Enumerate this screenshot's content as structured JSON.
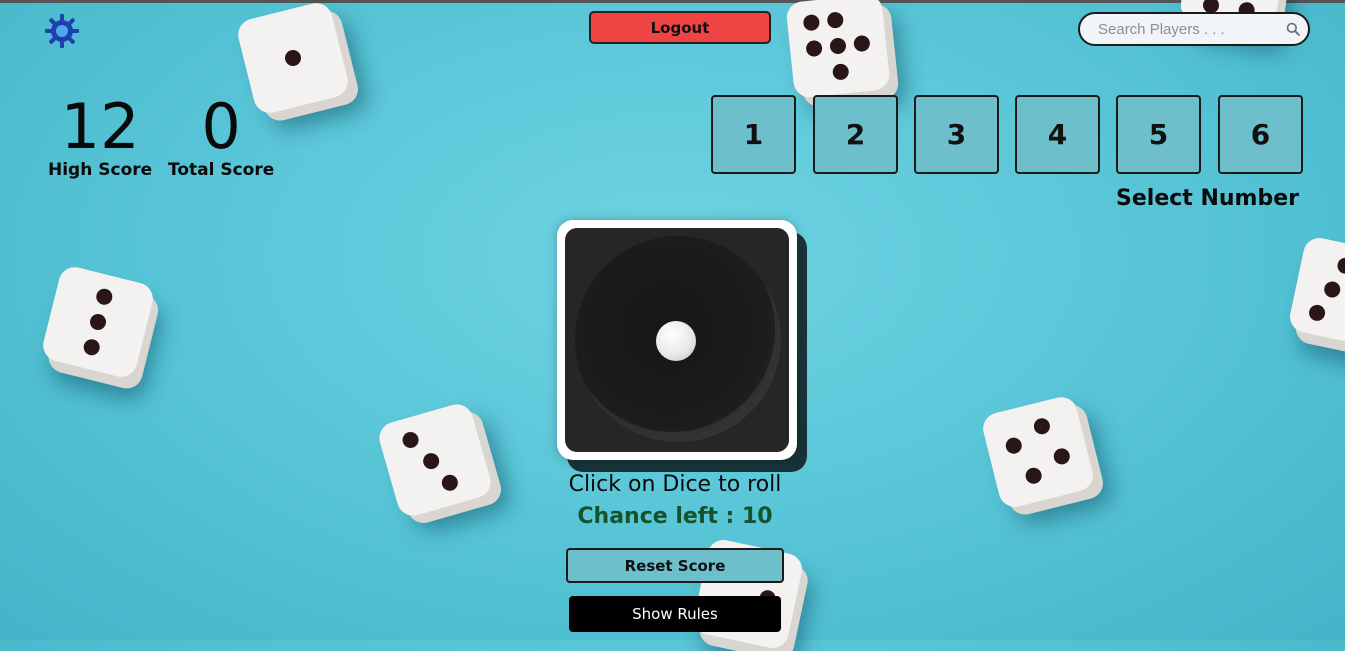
{
  "header": {
    "settings_icon": "gear-icon",
    "logout_label": "Logout",
    "search_placeholder": "Search Players . . .",
    "search_value": "",
    "search_icon": "magnifier-icon"
  },
  "scores": {
    "high_score": "12",
    "high_score_label": "High Score",
    "total_score": "0",
    "total_score_label": "Total Score"
  },
  "number_selector": {
    "options": [
      "1",
      "2",
      "3",
      "4",
      "5",
      "6"
    ],
    "label": "Select Number"
  },
  "dice": {
    "current_face": 1,
    "hint": "Click on Dice to roll",
    "chance_text": "Chance left : 10"
  },
  "actions": {
    "reset_label": "Reset Score",
    "rules_label": "Show Rules"
  },
  "colors": {
    "background": "#56c4d6",
    "logout": "#ef4444",
    "number_button": "#6dbfcc",
    "chance_text": "#14532d",
    "gear": "#1e40af"
  }
}
